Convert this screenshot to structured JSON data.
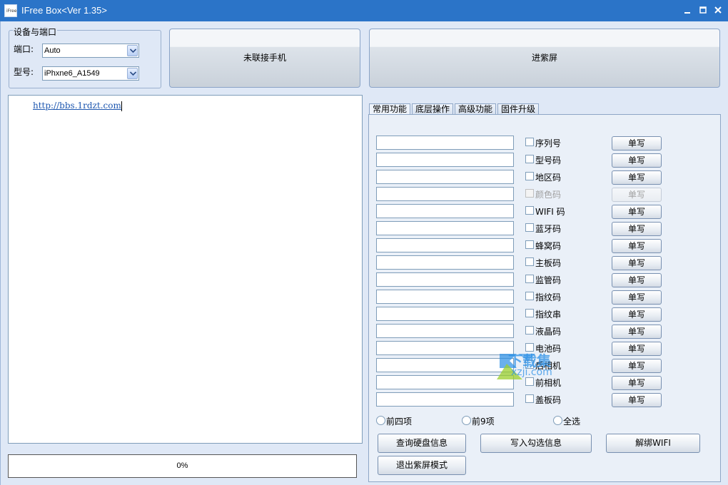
{
  "window": {
    "title": "IFree Box<Ver 1.35>",
    "icon_text": "iFree",
    "controls": [
      "minimize-icon",
      "maximize-icon",
      "close-icon"
    ]
  },
  "device_group": {
    "title": "设备与端口",
    "port_label": "端口:",
    "port_value": "Auto",
    "model_label": "型号:",
    "model_value": "iPhxne6_A1549"
  },
  "buttons": {
    "connect": "未联接手机",
    "purple_screen": "进紫屏"
  },
  "log": {
    "lines": [
      "http://bbs.1rdzt.com"
    ]
  },
  "progress": {
    "text": "0%",
    "value": 0
  },
  "tabs": [
    "常用功能",
    "底层操作",
    "高级功能",
    "固件升级"
  ],
  "rows": [
    {
      "label": "序列号",
      "button": "单写",
      "enabled": true
    },
    {
      "label": "型号码",
      "button": "单写",
      "enabled": true
    },
    {
      "label": "地区码",
      "button": "单写",
      "enabled": true
    },
    {
      "label": "颜色码",
      "button": "单写",
      "enabled": false
    },
    {
      "label": "WIFI 码",
      "button": "单写",
      "enabled": true
    },
    {
      "label": "蓝牙码",
      "button": "单写",
      "enabled": true
    },
    {
      "label": "蜂窝码",
      "button": "单写",
      "enabled": true
    },
    {
      "label": "主板码",
      "button": "单写",
      "enabled": true
    },
    {
      "label": "监管码",
      "button": "单写",
      "enabled": true
    },
    {
      "label": "指纹码",
      "button": "单写",
      "enabled": true
    },
    {
      "label": "指纹串",
      "button": "单写",
      "enabled": true
    },
    {
      "label": "液晶码",
      "button": "单写",
      "enabled": true
    },
    {
      "label": "电池码",
      "button": "单写",
      "enabled": true
    },
    {
      "label": "后相机",
      "button": "单写",
      "enabled": true
    },
    {
      "label": "前相机",
      "button": "单写",
      "enabled": true
    },
    {
      "label": "盖板码",
      "button": "单写",
      "enabled": true
    }
  ],
  "radios": [
    "前四项",
    "前9项",
    "全选"
  ],
  "actions": {
    "query_disk": "查询硬盘信息",
    "write_checked": "写入勾选信息",
    "unbind_wifi": "解绑WIFI",
    "exit_purple": "退出紫屏模式"
  },
  "watermark": {
    "text": "下载集",
    "sub": "xzji.com"
  },
  "colors": {
    "titlebar": "#2b74c8",
    "window_bg": "#dfe8f6",
    "link": "#1f58b0"
  }
}
